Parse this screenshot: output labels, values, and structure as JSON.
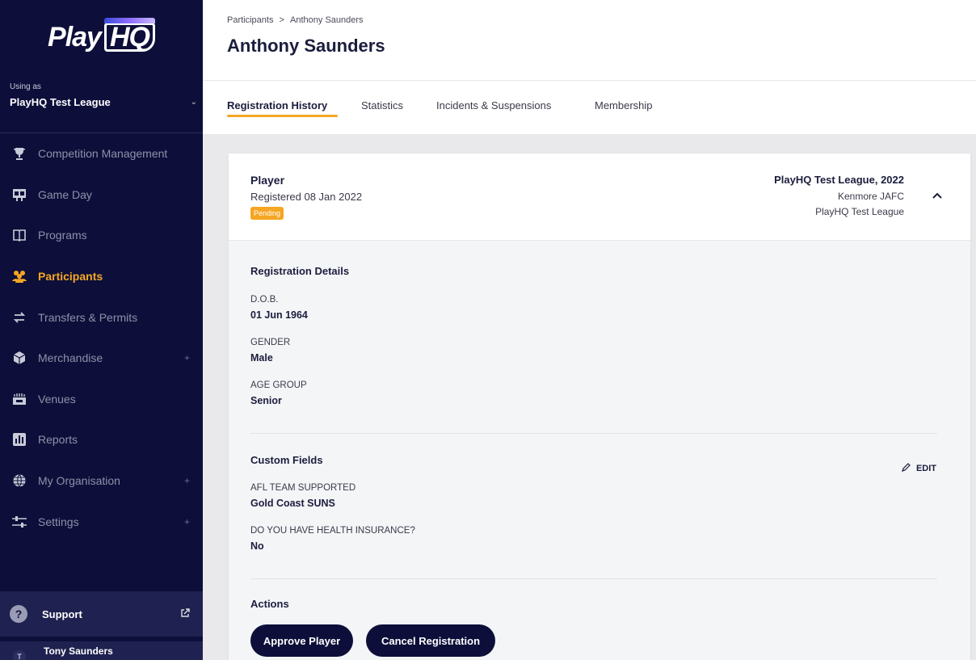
{
  "app": {
    "logo_text": "Play",
    "logo_hq": "HQ"
  },
  "sidebar": {
    "using_label": "Using as",
    "org_name": "PlayHQ Test League",
    "items": [
      {
        "label": "Competition Management",
        "icon": "trophy-icon",
        "active": false,
        "expandable": false
      },
      {
        "label": "Game Day",
        "icon": "scoreboard-icon",
        "active": false,
        "expandable": false
      },
      {
        "label": "Programs",
        "icon": "book-icon",
        "active": false,
        "expandable": false
      },
      {
        "label": "Participants",
        "icon": "people-icon",
        "active": true,
        "expandable": false
      },
      {
        "label": "Transfers & Permits",
        "icon": "transfer-arrows-icon",
        "active": false,
        "expandable": false
      },
      {
        "label": "Merchandise",
        "icon": "box-icon",
        "active": false,
        "expandable": true
      },
      {
        "label": "Venues",
        "icon": "stadium-icon",
        "active": false,
        "expandable": false
      },
      {
        "label": "Reports",
        "icon": "reports-icon",
        "active": false,
        "expandable": false
      },
      {
        "label": "My Organisation",
        "icon": "globe-icon",
        "active": false,
        "expandable": true
      },
      {
        "label": "Settings",
        "icon": "sliders-icon",
        "active": false,
        "expandable": true
      }
    ],
    "support_label": "Support",
    "user_name": "Tony Saunders",
    "user_initial": "T"
  },
  "header": {
    "breadcrumb_root": "Participants",
    "breadcrumb_sep": ">",
    "breadcrumb_current": "Anthony Saunders",
    "title": "Anthony Saunders"
  },
  "tabs": [
    {
      "label": "Registration History",
      "active": true
    },
    {
      "label": "Statistics",
      "active": false
    },
    {
      "label": "Incidents & Suspensions",
      "active": false
    },
    {
      "label": "Membership",
      "active": false
    }
  ],
  "registration": {
    "role": "Player",
    "registered": "Registered 08 Jan 2022",
    "status": "Pending",
    "competition": "PlayHQ Test League, 2022",
    "club": "Kenmore JAFC",
    "league": "PlayHQ Test League",
    "details_title": "Registration Details",
    "dob_label": "D.O.B.",
    "dob_value": "01 Jun 1964",
    "gender_label": "GENDER",
    "gender_value": "Male",
    "age_group_label": "AGE GROUP",
    "age_group_value": "Senior",
    "custom_title": "Custom Fields",
    "edit_label": "EDIT",
    "afl_label": "AFL TEAM SUPPORTED",
    "afl_value": "Gold Coast SUNS",
    "insurance_label": "DO YOU HAVE HEALTH INSURANCE?",
    "insurance_value": "No",
    "actions_title": "Actions",
    "approve_label": "Approve Player",
    "cancel_label": "Cancel Registration"
  },
  "colors": {
    "sidebar_bg": "#0d0f3a",
    "accent": "#f5a623",
    "button_bg": "#0d0f3a"
  }
}
